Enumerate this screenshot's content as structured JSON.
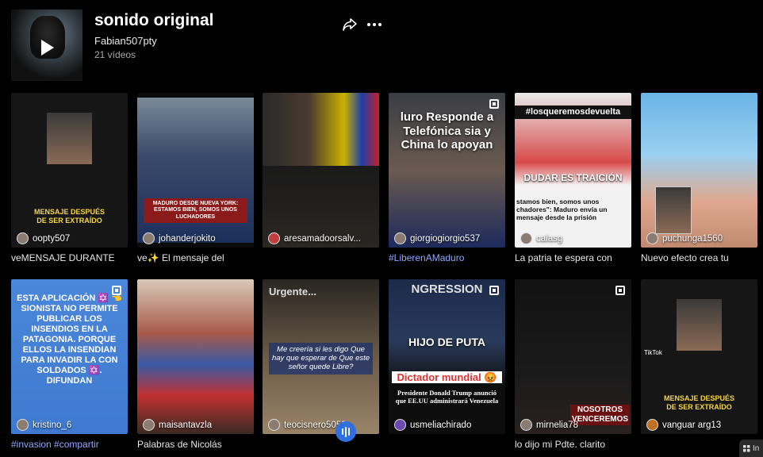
{
  "header": {
    "title": "sonido original",
    "author": "Fabian507pty",
    "video_count": "21 vídeos"
  },
  "videos": [
    {
      "user": "oopty507",
      "caption": "veMENSAJE DURANTE",
      "overlay": "MENSAJE DESPUÉS DE SER EXTRAÍDO",
      "tag": false
    },
    {
      "user": "johanderjokito",
      "caption": "ve✨ El mensaje del",
      "overlay": "MADURO DESDE NUEVA YORK: ESTAMOS BIEN, SOMOS UNOS LUCHADORES",
      "tag": false
    },
    {
      "user": "aresamadoorsalv...",
      "caption": "",
      "overlay": "",
      "tag": false
    },
    {
      "user": "giorgiogiorgio537",
      "caption": "#LiberenAMaduro",
      "overlay": "luro Responde a Telefónica sia y China lo apoyan",
      "tag": true
    },
    {
      "user": "calasg",
      "caption": "La patria te espera con",
      "overlay_top": "#losqueremosdevuelta",
      "overlay_mid": "DUDAR ES TRAICIÓN",
      "overlay_bottom": "stamos bien, somos unos chadores\": Maduro envía un mensaje desde la prisión",
      "tag": false
    },
    {
      "user": "puchunga1560",
      "caption": "Nuevo efecto crea tu",
      "overlay": "",
      "tag": false
    },
    {
      "user": "kristino_6",
      "caption": "#invasion #compartir",
      "overlay": "ESTA APLICACIÓN ✡️ 👈 SIONISTA NO PERMITE PUBLICAR LOS INSENDIOS EN LA PATAGONIA. PORQUE ELLOS LA INSENDIAN PARA INVADIR LA CON SOLDADOS ✡️. DIFUNDAN",
      "tag": true
    },
    {
      "user": "maisantavzla",
      "caption": "Palabras de Nicolás",
      "overlay": "",
      "tag": false
    },
    {
      "user": "teocisnero5053",
      "caption": "",
      "overlay_top": "Urgente...",
      "overlay": "Me creería si les digo Que hay que esperar de Que este señor quede Libre?",
      "tag": false
    },
    {
      "user": "usmeliachirado",
      "caption": "",
      "overlay_top": "NGRESSION",
      "overlay": "HIJO DE PUTA",
      "overlay_mid": "Dictador mundial 😡",
      "overlay_bottom": "Presidente Donald Trump anunció que EE.UU administrará Venezuela",
      "tag": false
    },
    {
      "user": "mirnelia78",
      "caption": "lo dijo mi Pdte. clarito",
      "overlay": "NOSOTROS VENCEREMOS",
      "tag": false
    },
    {
      "user": "vanguar arg13",
      "caption": "",
      "overlay": "MENSAJE DESPUÉS DE SER EXTRAÍDO",
      "tiktok": "TikTok",
      "tag": false
    }
  ],
  "corner_chip": "In",
  "colors": {
    "background": "#000000",
    "tag_text": "#8fa8ff",
    "fab": "#2f6fde"
  }
}
